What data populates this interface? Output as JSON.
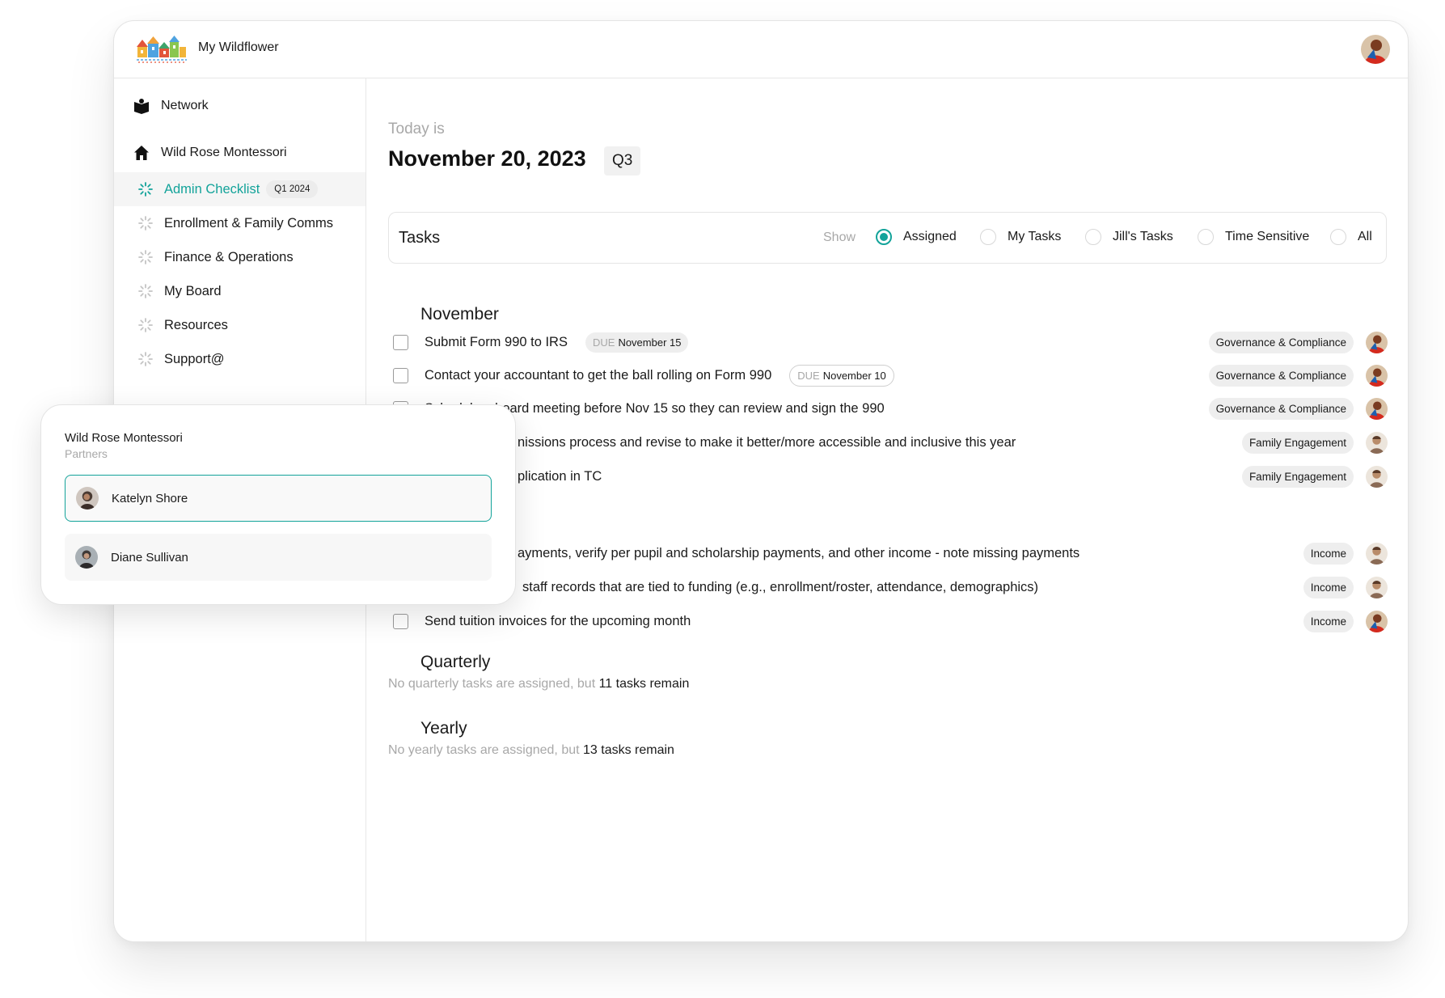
{
  "app": {
    "title": "My Wildflower",
    "logo": "wildflower-houses-logo"
  },
  "sidebar": {
    "network_label": "Network",
    "school_label": "Wild Rose Montessori",
    "items": [
      {
        "label": "Admin Checklist",
        "badge": "Q1 2024",
        "active": true
      },
      {
        "label": "Enrollment & Family Comms"
      },
      {
        "label": "Finance & Operations"
      },
      {
        "label": "My Board"
      },
      {
        "label": "Resources"
      },
      {
        "label": "Support@"
      }
    ]
  },
  "main": {
    "today_label": "Today is",
    "date": "November 20, 2023",
    "quarter": "Q3"
  },
  "tasks": {
    "title": "Tasks",
    "show_label": "Show",
    "filters": [
      {
        "label": "Assigned",
        "selected": true
      },
      {
        "label": "My Tasks",
        "selected": false
      },
      {
        "label": "Jill's Tasks",
        "selected": false
      },
      {
        "label": "Time Sensitive",
        "selected": false
      },
      {
        "label": "All",
        "selected": false
      }
    ],
    "sections": {
      "november": {
        "title": "November",
        "items": [
          {
            "text": "Submit Form 990 to IRS",
            "due_word": "DUE",
            "due_date": "November 15",
            "tag": "Governance & Compliance",
            "assignee": "avatar-red"
          },
          {
            "text": "Contact your accountant to get the ball rolling on Form 990",
            "due_word": "DUE",
            "due_date": "November 10",
            "tag": "Governance & Compliance",
            "assignee": "avatar-red"
          },
          {
            "text": "Schedule a board meeting before Nov 15 so they can review and sign the 990",
            "tag": "Governance & Compliance",
            "assignee": "avatar-red"
          },
          {
            "text": "nissions process and revise to make it better/more accessible and inclusive this year",
            "tag": "Family Engagement",
            "assignee": "avatar-light"
          },
          {
            "text": "plication in TC",
            "tag": "Family Engagement",
            "assignee": "avatar-light"
          }
        ]
      },
      "monthly": {
        "items": [
          {
            "text": "ayments, verify per pupil and scholarship payments, and other income - note missing payments",
            "tag": "Income",
            "assignee": "avatar-light"
          },
          {
            "text": "staff records that are tied to funding (e.g., enrollment/roster, attendance, demographics)",
            "tag": "Income",
            "assignee": "avatar-light"
          },
          {
            "text": "Send tuition invoices for the upcoming month",
            "tag": "Income",
            "assignee": "avatar-red"
          }
        ]
      },
      "quarterly": {
        "title": "Quarterly",
        "note_prefix": "No quarterly tasks are assigned, but",
        "note_count": "11 tasks remain"
      },
      "yearly": {
        "title": "Yearly",
        "note_prefix": "No yearly tasks are assigned, but",
        "note_count": "13 tasks remain"
      }
    }
  },
  "popup": {
    "school": "Wild Rose Montessori",
    "subtitle": "Partners",
    "partners": [
      {
        "name": "Katelyn Shore",
        "selected": true
      },
      {
        "name": "Diane Sullivan",
        "selected": false
      }
    ]
  },
  "colors": {
    "accent": "#13a39a",
    "tag_bg": "#eeeeee",
    "muted_text": "#a8a8a8"
  }
}
